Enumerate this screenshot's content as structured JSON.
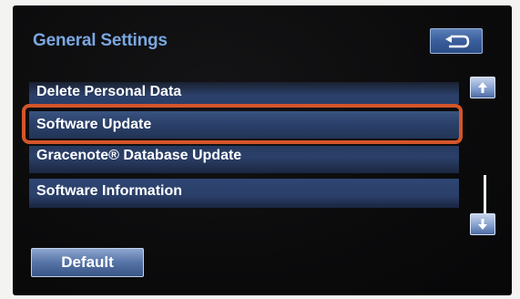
{
  "header": {
    "title": "General Settings"
  },
  "menu": {
    "items": [
      {
        "label": "Delete Personal Data"
      },
      {
        "label": "Software Update"
      },
      {
        "label": "Gracenote® Database Update"
      },
      {
        "label": "Software Information"
      }
    ],
    "highlighted_item": "Software Update"
  },
  "footer": {
    "default_label": "Default"
  },
  "icons": {
    "back": "back-arrow-icon",
    "scroll_up": "arrow-up-icon",
    "scroll_down": "arrow-down-icon"
  },
  "colors": {
    "title": "#7aa7e0",
    "row": "#2b406a",
    "highlight_outline": "#d4552a",
    "button": "#5673a6"
  }
}
